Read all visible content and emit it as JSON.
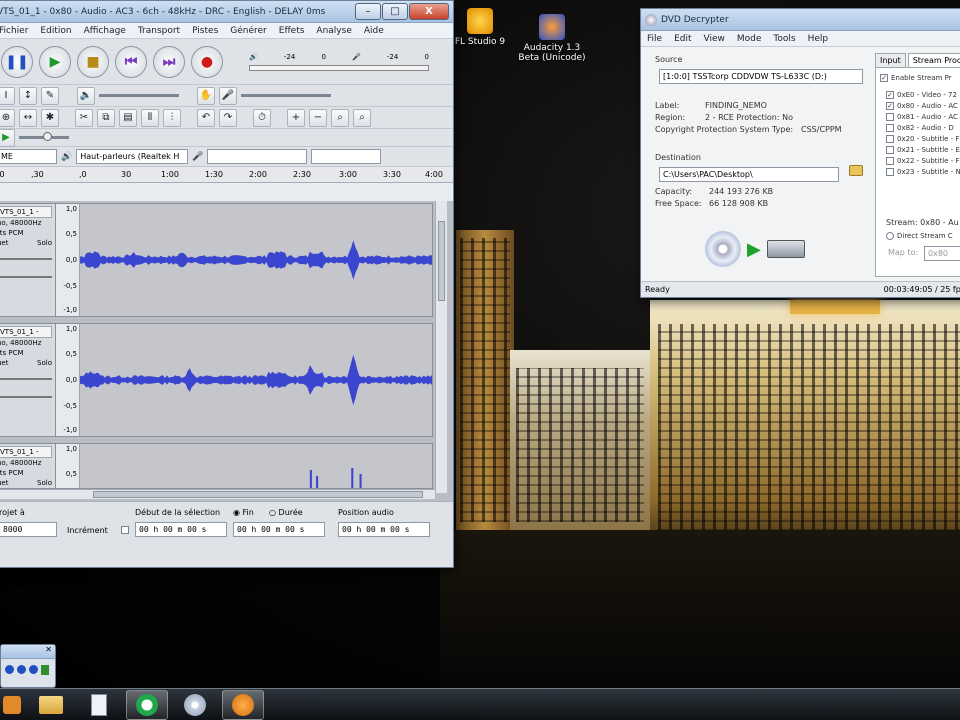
{
  "colors": {
    "wave": "#3a46d0",
    "titlebar": "#b5cbe6"
  },
  "desktop": {
    "icons": [
      {
        "label": "FL Studio 9",
        "icon": "fl-studio-icon"
      },
      {
        "label": "Audacity 1.3 Beta (Unicode)",
        "icon": "audacity-icon"
      }
    ]
  },
  "audacity": {
    "title": "VTS_01_1 - 0x80 - Audio - AC3 - 6ch - 48kHz - DRC - English - DELAY 0ms",
    "caption": {
      "min": "–",
      "max": "□",
      "close": "X"
    },
    "menu": [
      "Fichier",
      "Edition",
      "Affichage",
      "Transport",
      "Pistes",
      "Générer",
      "Effets",
      "Analyse",
      "Aide"
    ],
    "meter_labels": [
      "-24",
      "0",
      "-24",
      "0"
    ],
    "device": {
      "host": "ME",
      "output": "Haut-parleurs (Realtek H"
    },
    "ruler": [
      ".0",
      ",30",
      ",0",
      "30",
      "1:00",
      "1:30",
      "2:00",
      "2:30",
      "3:00",
      "3:30",
      "4:00"
    ],
    "tracks": [
      {
        "name": "VTS_01_1 -",
        "rate": "no, 48000Hz",
        "format": "tts PCM",
        "mute": "uet",
        "solo": "Solo",
        "scale": [
          "1,0",
          "0,5",
          "0,0",
          "-0,5",
          "-1,0"
        ]
      },
      {
        "name": "VTS_01_1 -",
        "rate": "no, 48000Hz",
        "format": "tts PCM",
        "mute": "uet",
        "solo": "Solo",
        "scale": [
          "1,0",
          "0,5",
          "0,0",
          "-0,5",
          "-1,0"
        ]
      },
      {
        "name": "VTS_01_1 -",
        "rate": "no, 48000Hz",
        "format": "tts PCM",
        "mute": "uet",
        "solo": "Solo",
        "scale": [
          "1,0",
          "0,5"
        ]
      }
    ],
    "selection": {
      "rate_label": "rojet à",
      "rate_value": "8000",
      "snap_label": "Incrément",
      "start_label": "Début de la sélection",
      "end_radio": "Fin",
      "length_radio": "Durée",
      "pos_label": "Position audio",
      "start_time": "00 h 00 m 00 s",
      "end_time": "00 h 00 m 00 s",
      "pos_time": "00 h 00 m 00 s"
    }
  },
  "dvd": {
    "title": "DVD Decrypter",
    "menu": [
      "File",
      "Edit",
      "View",
      "Mode",
      "Tools",
      "Help"
    ],
    "source_label": "Source",
    "drive": "[1:0:0] TSSTcorp CDDVDW TS-L633C (D:)",
    "label_key": "Label:",
    "label_val": "FINDING_NEMO",
    "region_key": "Region:",
    "region_val": "2 - RCE Protection: No",
    "copy_key": "Copyright Protection System Type:",
    "copy_val": "CSS/CPPM",
    "dest_label": "Destination",
    "dest_path": "C:\\Users\\PAC\\Desktop\\",
    "capacity_key": "Capacity:",
    "capacity_val": "244 193 276 KB",
    "free_key": "Free Space:",
    "free_val": "66 128 908 KB",
    "tabs": [
      "Input",
      "Stream Proc"
    ],
    "enable_label": "Enable Stream Pr",
    "streams": [
      {
        "text": "0xE0 - Video - 72",
        "checked": true
      },
      {
        "text": "0x80 - Audio - AC",
        "checked": true
      },
      {
        "text": "0x81 - Audio - AC",
        "checked": false
      },
      {
        "text": "0x82 - Audio - D",
        "checked": false
      },
      {
        "text": "0x20 - Subtitle - F",
        "checked": false
      },
      {
        "text": "0x21 - Subtitle - E",
        "checked": false
      },
      {
        "text": "0x22 - Subtitle - F",
        "checked": false
      },
      {
        "text": "0x23 - Subtitle - N",
        "checked": false
      }
    ],
    "stream_line": "Stream: 0x80 - Au",
    "direct_label": "Direct Stream C",
    "map_label": "Map to:",
    "map_val": "0x80",
    "status_left": "Ready",
    "status_right": "00:03:49:05 / 25 fps"
  }
}
